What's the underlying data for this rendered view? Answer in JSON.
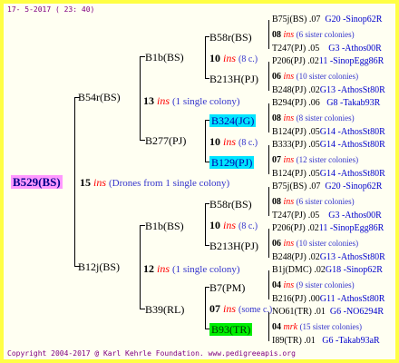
{
  "header": {
    "date": "17-  5-2017 ( 23: 40)"
  },
  "root": {
    "id": "B529(BS)",
    "count": "15",
    "ins": "ins",
    "note": "(Drones from 1 single colony)"
  },
  "upper": {
    "parent": "B54r(BS)",
    "count": "13",
    "ins": "ins",
    "note": "(1 single colony)",
    "mother": {
      "id": "B1b(BS)",
      "left": {
        "id": "B58r(BS)",
        "count": "10",
        "ins": "ins",
        "note": "(8 c.)"
      },
      "right": {
        "id": "B213H(PJ)"
      }
    },
    "sister": {
      "id": "B277(PJ)",
      "left": {
        "id": "B324(JG)"
      },
      "count": "10",
      "ins": "ins",
      "note": "(8 c.)",
      "right": {
        "id": "B129(PJ)"
      }
    }
  },
  "lower": {
    "parent": "B12j(BS)",
    "count": "12",
    "ins": "ins",
    "note": "(1 single colony)",
    "mother": {
      "id": "B1b(BS)",
      "left": {
        "id": "B58r(BS)",
        "count": "10",
        "ins": "ins",
        "note": "(8 c.)"
      },
      "right": {
        "id": "B213H(PJ)"
      }
    },
    "sister": {
      "id": "B39(RL)",
      "count": "07",
      "ins": "ins",
      "note": "(some c.)",
      "left": {
        "id": "B7(PM)"
      },
      "right": {
        "id": "B93(TR)"
      }
    }
  },
  "leaves": [
    {
      "a": "B75j(BS)",
      "b": ".07",
      "c": "G20 -Sinop62R"
    },
    {
      "a": "08",
      "ins": "ins",
      "note": "(6 sister colonies)"
    },
    {
      "a": "T247(PJ)",
      "b": ".05",
      "c": "G3 -Athos00R"
    },
    {
      "a": "P206(PJ)",
      "b": ".02",
      "c": "11 -SinopEgg86R"
    },
    {
      "a": "06",
      "ins": "ins",
      "note": "(10 sister colonies)"
    },
    {
      "a": "B248(PJ)",
      "b": ".02",
      "c": "G13 -AthosSt80R"
    },
    {
      "a": "B294(PJ)",
      "b": ".06",
      "c": "G8 -Takab93R"
    },
    {
      "a": "08",
      "ins": "ins",
      "note": "(8 sister colonies)"
    },
    {
      "a": "B124(PJ)",
      "b": ".05",
      "c": "G14 -AthosSt80R"
    },
    {
      "a": "B333(PJ)",
      "b": ".05",
      "c": "G14 -AthosSt80R"
    },
    {
      "a": "07",
      "ins": "ins",
      "note": "(12 sister colonies)"
    },
    {
      "a": "B124(PJ)",
      "b": ".05",
      "c": "G14 -AthosSt80R"
    },
    {
      "a": "B75j(BS)",
      "b": ".07",
      "c": "G20 -Sinop62R"
    },
    {
      "a": "08",
      "ins": "ins",
      "note": "(6 sister colonies)"
    },
    {
      "a": "T247(PJ)",
      "b": ".05",
      "c": "G3 -Athos00R"
    },
    {
      "a": "P206(PJ)",
      "b": ".02",
      "c": "11 -SinopEgg86R"
    },
    {
      "a": "06",
      "ins": "ins",
      "note": "(10 sister colonies)"
    },
    {
      "a": "B248(PJ)",
      "b": ".02",
      "c": "G13 -AthosSt80R"
    },
    {
      "a": "B1j(DMC)",
      "b": ".02",
      "c": "G18 -Sinop62R"
    },
    {
      "a": "04",
      "ins": "ins",
      "note": "(9 sister colonies)"
    },
    {
      "a": "B216(PJ)",
      "b": ".00",
      "c": "G11 -AthosSt80R"
    },
    {
      "a": "NO61(TR)",
      "b": ".01",
      "c": "G6 -NO6294R"
    },
    {
      "a": "04",
      "ins": "mrk",
      "note": "(15 sister colonies)"
    },
    {
      "a": "I89(TR)",
      "b": ".01",
      "c": "G6 -Takab93aR"
    }
  ],
  "footer": {
    "copyright": "Copyright 2004-2017 @ Karl Kehrle Foundation.   www.pedigreeapis.org"
  }
}
